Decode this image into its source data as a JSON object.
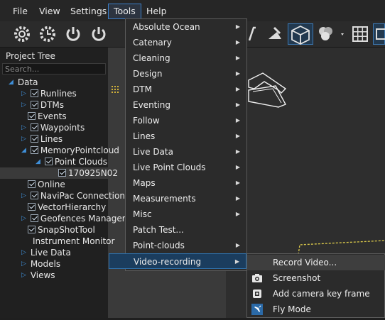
{
  "menubar": {
    "items": [
      "File",
      "View",
      "Settings",
      "Tools",
      "Help"
    ]
  },
  "tree": {
    "title": "Project Tree",
    "search_placeholder": "Search...",
    "rows": [
      "Data",
      "Runlines",
      "DTMs",
      "Events",
      "Waypoints",
      "Lines",
      "MemoryPointcloud",
      "Point Clouds",
      "170925N02",
      "Online",
      "NaviPac Connection",
      "VectorHierarchy",
      "Geofences Manager",
      "SnapShotTool",
      "Instrument Monitor",
      "Live Data",
      "Models",
      "Views"
    ]
  },
  "tools_menu": {
    "items": [
      "Absolute Ocean",
      "Catenary",
      "Cleaning",
      "Design",
      "DTM",
      "Eventing",
      "Follow",
      "Lines",
      "Live Data",
      "Live Point Clouds",
      "Maps",
      "Measurements",
      "Misc",
      "Patch Test...",
      "Point-clouds",
      "Video-recording"
    ]
  },
  "video_submenu": {
    "items": [
      "Record Video...",
      "Screenshot",
      "Add camera key frame",
      "Fly Mode"
    ]
  },
  "colors": {
    "accent": "#3b7ec8",
    "highlight": "#1b3d5e",
    "check": "#d8e6f4"
  }
}
